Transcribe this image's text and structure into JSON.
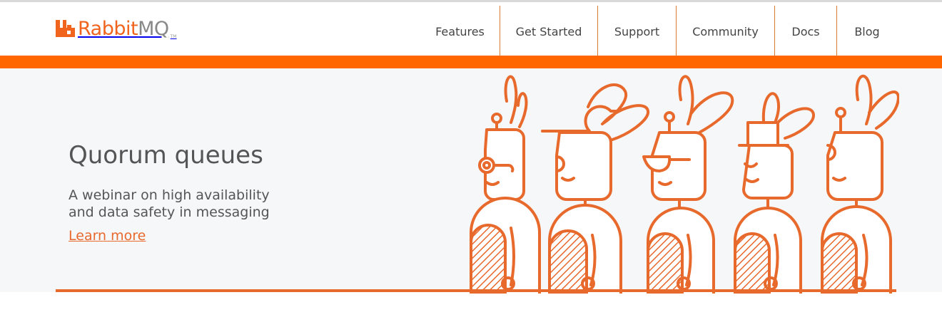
{
  "brand": {
    "logo_main": "Rabbit",
    "logo_accent": "MQ",
    "logo_tm": "TM",
    "color_orange": "#ff6600",
    "color_line": "#e8692c"
  },
  "nav": {
    "items": [
      {
        "label": "Features"
      },
      {
        "label": "Get Started"
      },
      {
        "label": "Support"
      },
      {
        "label": "Community"
      },
      {
        "label": "Docs"
      },
      {
        "label": "Blog"
      }
    ]
  },
  "hero": {
    "title": "Quorum queues",
    "subtitle_line1": "A webinar on high availability",
    "subtitle_line2": "and data safety in messaging",
    "link": "Learn more",
    "illustration": "rabbit-robots-lineup"
  }
}
